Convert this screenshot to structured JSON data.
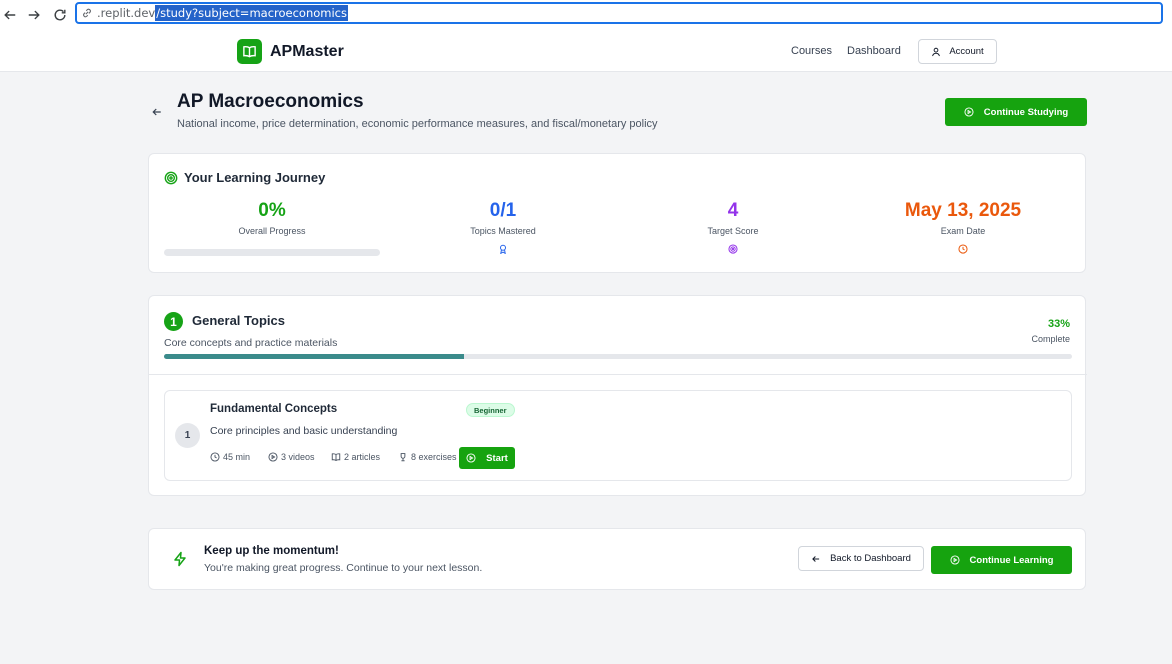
{
  "browser": {
    "url_host": ".replit.dev",
    "url_path": "/study?subject=macroeconomics"
  },
  "header": {
    "brand": "APMaster",
    "nav": [
      "Courses",
      "Dashboard"
    ],
    "account_label": "Account"
  },
  "page": {
    "title": "AP Macroeconomics",
    "subtitle": "National income, price determination, economic performance measures, and fiscal/monetary policy",
    "continue_studying_label": "Continue Studying"
  },
  "journey": {
    "title": "Your Learning Journey",
    "stats": [
      {
        "value": "0%",
        "label": "Overall Progress",
        "color": "#16a316",
        "icon": "progress-bar"
      },
      {
        "value": "0/1",
        "label": "Topics Mastered",
        "color": "#2563eb",
        "icon": "award-icon"
      },
      {
        "value": "4",
        "label": "Target Score",
        "color": "#9333ea",
        "icon": "target-icon"
      },
      {
        "value": "May 13, 2025",
        "label": "Exam Date",
        "color": "#ea580c",
        "icon": "clock-icon"
      }
    ],
    "overall_progress": 0
  },
  "topic": {
    "number": "1",
    "title": "General Topics",
    "subtitle": "Core concepts and practice materials",
    "percent_label": "33%",
    "complete_label": "Complete",
    "progress": 0.33,
    "lessons": [
      {
        "number": "1",
        "title": "Fundamental Concepts",
        "level": "Beginner",
        "description": "Core principles and basic understanding",
        "duration": "45 min",
        "videos": "3 videos",
        "articles": "2 articles",
        "exercises": "8 exercises",
        "start_label": "Start"
      }
    ]
  },
  "momentum": {
    "title": "Keep up the momentum!",
    "subtitle": "You're making great progress. Continue to your next lesson.",
    "back_label": "Back to Dashboard",
    "continue_label": "Continue Learning"
  },
  "colors": {
    "accent": "#16a30f",
    "topic_progress": "#3b8b8b"
  }
}
